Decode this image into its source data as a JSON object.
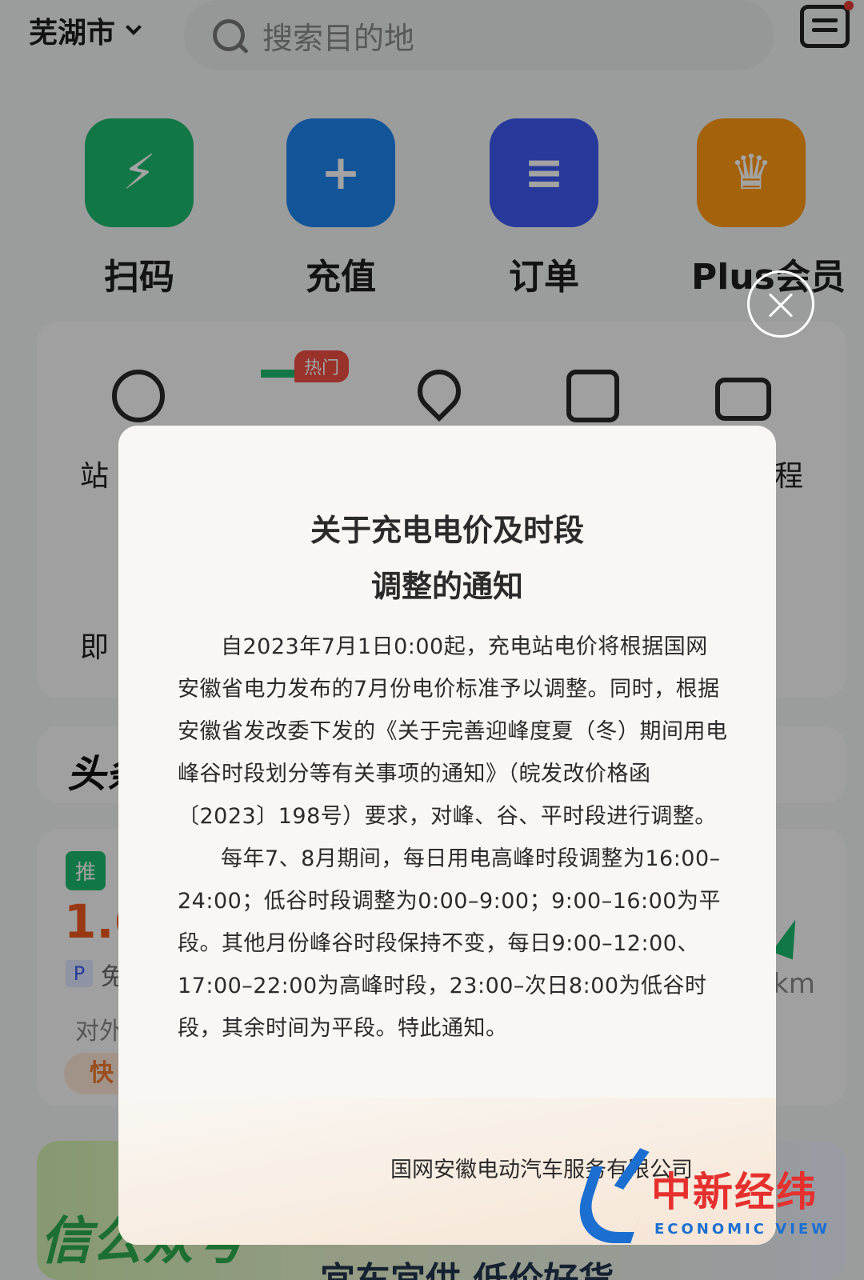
{
  "header": {
    "city": "芜湖市",
    "search_placeholder": "搜索目的地"
  },
  "quick_actions": [
    {
      "label": "扫码",
      "icon": "scan-charge-icon"
    },
    {
      "label": "充值",
      "icon": "wallet-add-icon"
    },
    {
      "label": "订单",
      "icon": "order-list-icon"
    },
    {
      "label": "Plus会员",
      "icon": "crown-icon"
    }
  ],
  "features": {
    "hot_badge": "热门",
    "label_partial_1": "站",
    "label_partial_2": "程",
    "label_partial_3": "即"
  },
  "news": {
    "headline_partial": "头条"
  },
  "station": {
    "recommend_partial": "推",
    "price_partial": "1.6",
    "parking": "P",
    "free_partial": "免",
    "open_partial": "对外",
    "fast_partial": "快",
    "distance_partial": "km"
  },
  "banner": {
    "left_partial": "信公众号",
    "middle_partial": "宜车宜供   低价好货"
  },
  "dialog": {
    "title_line1": "关于充电电价及时段",
    "title_line2": "调整的通知",
    "paragraph1": "自2023年7月1日0:00起，充电站电价将根据国网安徽省电力发布的7月份电价标准予以调整。同时，根据安徽省发改委下发的《关于完善迎峰度夏（冬）期间用电峰谷时段划分等有关事项的通知》（皖发改价格函〔2023〕198号）要求，对峰、谷、平时段进行调整。",
    "paragraph2": "每年7、8月期间，每日用电高峰时段调整为16:00–24:00；低谷时段调整为0:00–9:00；9:00–16:00为平段。其他月份峰谷时段保持不变，每日9:00–12:00、17:00–22:00为高峰时段，23:00–次日8:00为低谷时段，其余时间为平段。特此通知。",
    "signature": "国网安徽电动汽车服务有限公司"
  },
  "watermark": {
    "cn": "中新经纬",
    "en": "ECONOMIC VIEW"
  },
  "colors": {
    "scan": "#1dbb6e",
    "recharge": "#1f86f0",
    "orders": "#3d5af2",
    "plus": "#ff9a12",
    "hot": "#ef4f44",
    "price": "#f05a1e"
  }
}
